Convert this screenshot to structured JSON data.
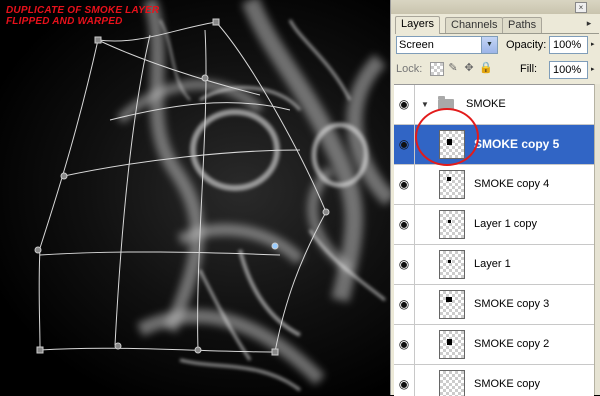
{
  "canvas": {
    "caption": [
      "DUPLICATE OF SMOKE LAYER",
      "FLIPPED AND WARPED"
    ]
  },
  "panel": {
    "tabs": [
      {
        "label": "Layers",
        "active": true
      },
      {
        "label": "Channels",
        "active": false
      },
      {
        "label": "Paths",
        "active": false
      }
    ],
    "close_glyph": "×",
    "menu_glyph": "▸",
    "blend_mode": "Screen",
    "opacity_label": "Opacity:",
    "opacity_value": "100%",
    "lock_label": "Lock:",
    "fill_label": "Fill:",
    "fill_value": "100%",
    "lock_icons": [
      "transparency-lock-icon",
      "brush-lock-icon",
      "move-lock-icon",
      "padlock-icon"
    ],
    "group": {
      "name": "SMOKE",
      "expanded": true
    },
    "layers": [
      {
        "name": "SMOKE copy 5",
        "selected": true
      },
      {
        "name": "SMOKE copy 4",
        "selected": false
      },
      {
        "name": "Layer 1 copy",
        "selected": false
      },
      {
        "name": "Layer 1",
        "selected": false
      },
      {
        "name": "SMOKE copy 3",
        "selected": false
      },
      {
        "name": "SMOKE copy 2",
        "selected": false
      },
      {
        "name": "SMOKE copy",
        "selected": false
      }
    ],
    "highlight_color": "#3165c5",
    "annotation_color": "#e21b1b"
  }
}
